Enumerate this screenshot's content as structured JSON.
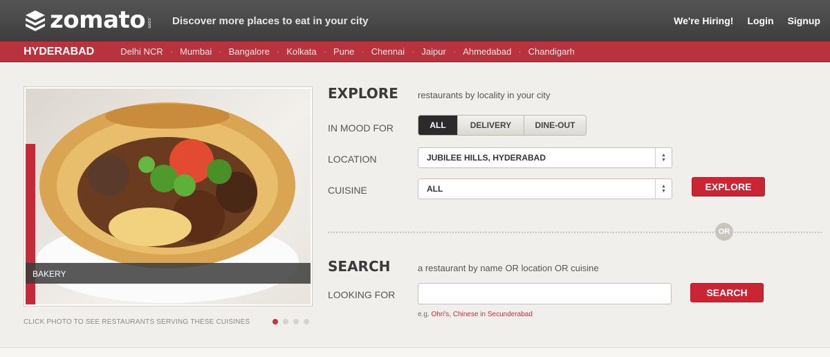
{
  "header": {
    "logo_text": "zomato",
    "logo_suffix": ".com",
    "tagline": "Discover more places to eat in your city",
    "nav": [
      "We're Hiring!",
      "Login",
      "Signup"
    ]
  },
  "citybar": {
    "current_city": "HYDERABAD",
    "cities": [
      "Delhi NCR",
      "Mumbai",
      "Bangalore",
      "Kolkata",
      "Pune",
      "Chennai",
      "Jaipur",
      "Ahmedabad",
      "Chandigarh"
    ],
    "separator": "·"
  },
  "photo": {
    "caption": "BAKERY",
    "hint": "CLICK PHOTO TO SEE RESTAURANTS SERVING THESE CUISINES",
    "slide_count": 4,
    "active_slide": 1
  },
  "explore": {
    "title": "EXPLORE",
    "subtitle": "restaurants by locality in your city",
    "mood_label": "IN MOOD FOR",
    "mood_options": [
      "ALL",
      "DELIVERY",
      "DINE-OUT"
    ],
    "mood_selected": "ALL",
    "location_label": "LOCATION",
    "location_value": "JUBILEE HILLS, HYDERABAD",
    "cuisine_label": "CUISINE",
    "cuisine_value": "ALL",
    "button": "EXPLORE"
  },
  "or_label": "OR",
  "search": {
    "title": "SEARCH",
    "subtitle": "a restaurant by name OR location OR cuisine",
    "looking_label": "LOOKING FOR",
    "input_value": "",
    "button": "SEARCH",
    "example_prefix": "e.g.",
    "example_text": "Ohri's, Chinese in Secunderabad"
  },
  "colors": {
    "header_bg": "#444444",
    "brand_red": "#b8333d",
    "button_red": "#cb2433",
    "page_bg": "#f1efeb"
  }
}
